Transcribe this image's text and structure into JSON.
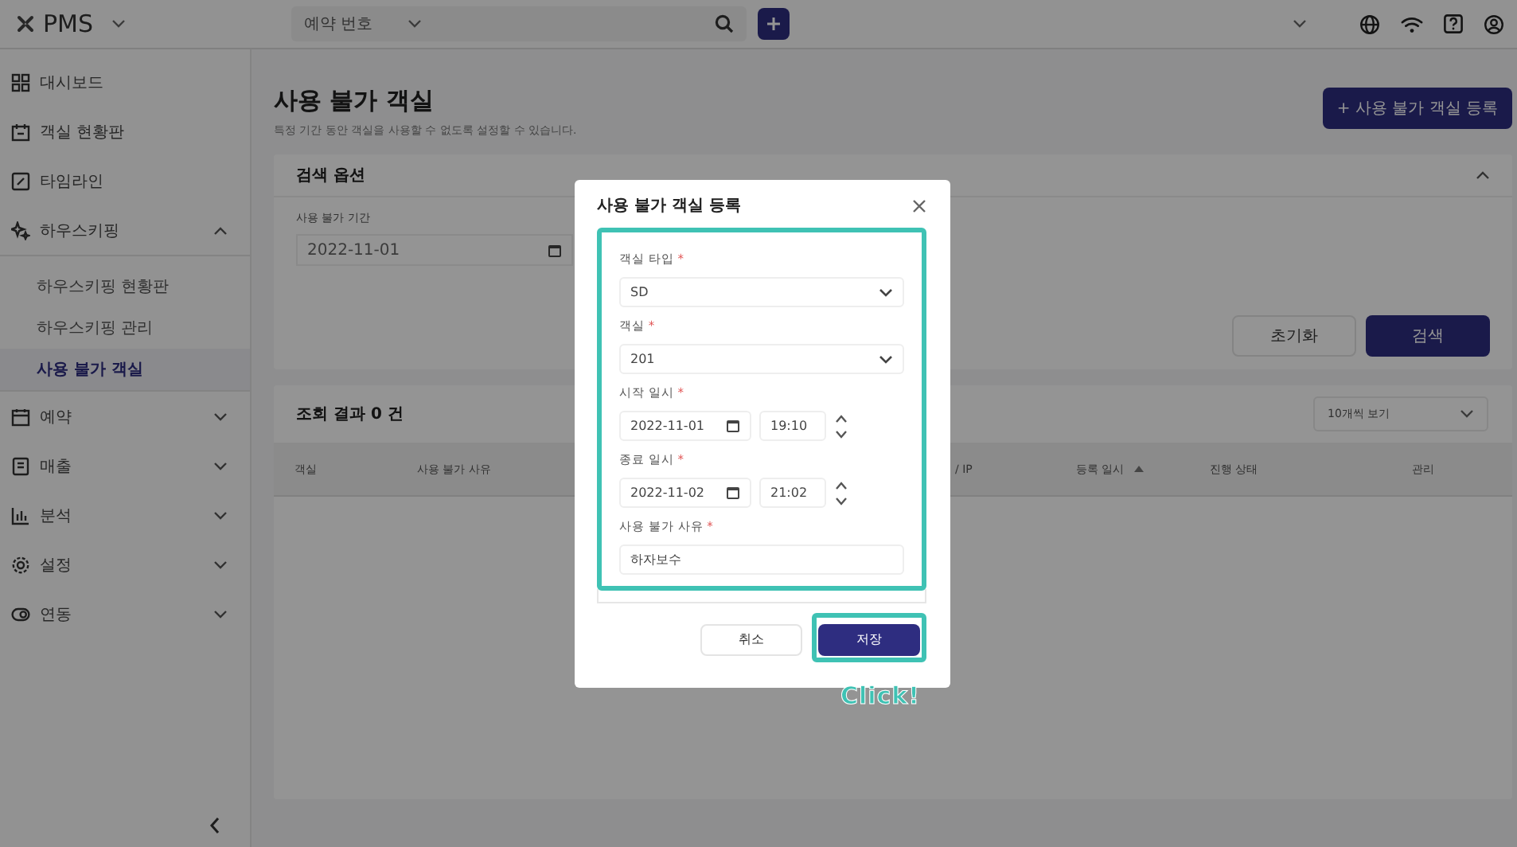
{
  "topbar": {
    "logo": "PMS",
    "search": {
      "category": "예약 번호"
    }
  },
  "sidebar": {
    "items": [
      {
        "label": "대시보드"
      },
      {
        "label": "객실 현황판"
      },
      {
        "label": "타임라인"
      },
      {
        "label": "하우스키핑",
        "expanded": true,
        "children": [
          {
            "label": "하우스키핑 현황판",
            "selected": false
          },
          {
            "label": "하우스키핑 관리",
            "selected": false
          },
          {
            "label": "사용 불가 객실",
            "selected": true
          }
        ]
      },
      {
        "label": "예약",
        "expanded": false
      },
      {
        "label": "매출",
        "expanded": false
      },
      {
        "label": "분석",
        "expanded": false
      },
      {
        "label": "설정",
        "expanded": false
      },
      {
        "label": "연동",
        "expanded": false
      }
    ]
  },
  "page": {
    "title": "사용 불가 객실",
    "description": "특정 기간 동안 객실을 사용할 수 없도록 설정할 수 있습니다.",
    "add_button": "+ 사용 불가 객실 등록"
  },
  "search_options": {
    "title": "검색 옵션",
    "expanded": true,
    "period_label": "사용 불가 기간",
    "period_start": "2022-11-01",
    "reset_button": "초기화",
    "search_button": "검색"
  },
  "results": {
    "title": "조회 결과 0 건",
    "page_size": "10개씩 보기",
    "columns": [
      {
        "label": "객실",
        "sorted": false
      },
      {
        "label": "사용 불가 사유",
        "sorted": false
      },
      {
        "label": "/ IP",
        "sorted": false
      },
      {
        "label": "등록 일시",
        "sorted": true
      },
      {
        "label": "진행 상태",
        "sorted": false
      },
      {
        "label": "관리",
        "sorted": false
      }
    ]
  },
  "modal": {
    "title": "사용 불가 객실 등록",
    "highlighted": true,
    "fields": [
      {
        "kind": "select",
        "label": "객실 타입",
        "required_mark": "*",
        "value": "SD"
      },
      {
        "kind": "select",
        "label": "객실",
        "required_mark": "*",
        "value": "201"
      },
      {
        "kind": "datetime",
        "label": "시작 일시",
        "required_mark": "*",
        "date": "2022-11-01",
        "time": "19:10"
      },
      {
        "kind": "datetime",
        "label": "종료 일시",
        "required_mark": "*",
        "date": "2022-11-02",
        "time": "21:02"
      },
      {
        "kind": "text",
        "label": "사용 불가 사유",
        "required_mark": "*",
        "value": "하자보수"
      }
    ],
    "buttons": [
      {
        "label": "취소",
        "primary": false,
        "highlighted": false
      },
      {
        "label": "저장",
        "primary": true,
        "highlighted": true
      }
    ]
  },
  "annotation": {
    "label": "Click!"
  }
}
